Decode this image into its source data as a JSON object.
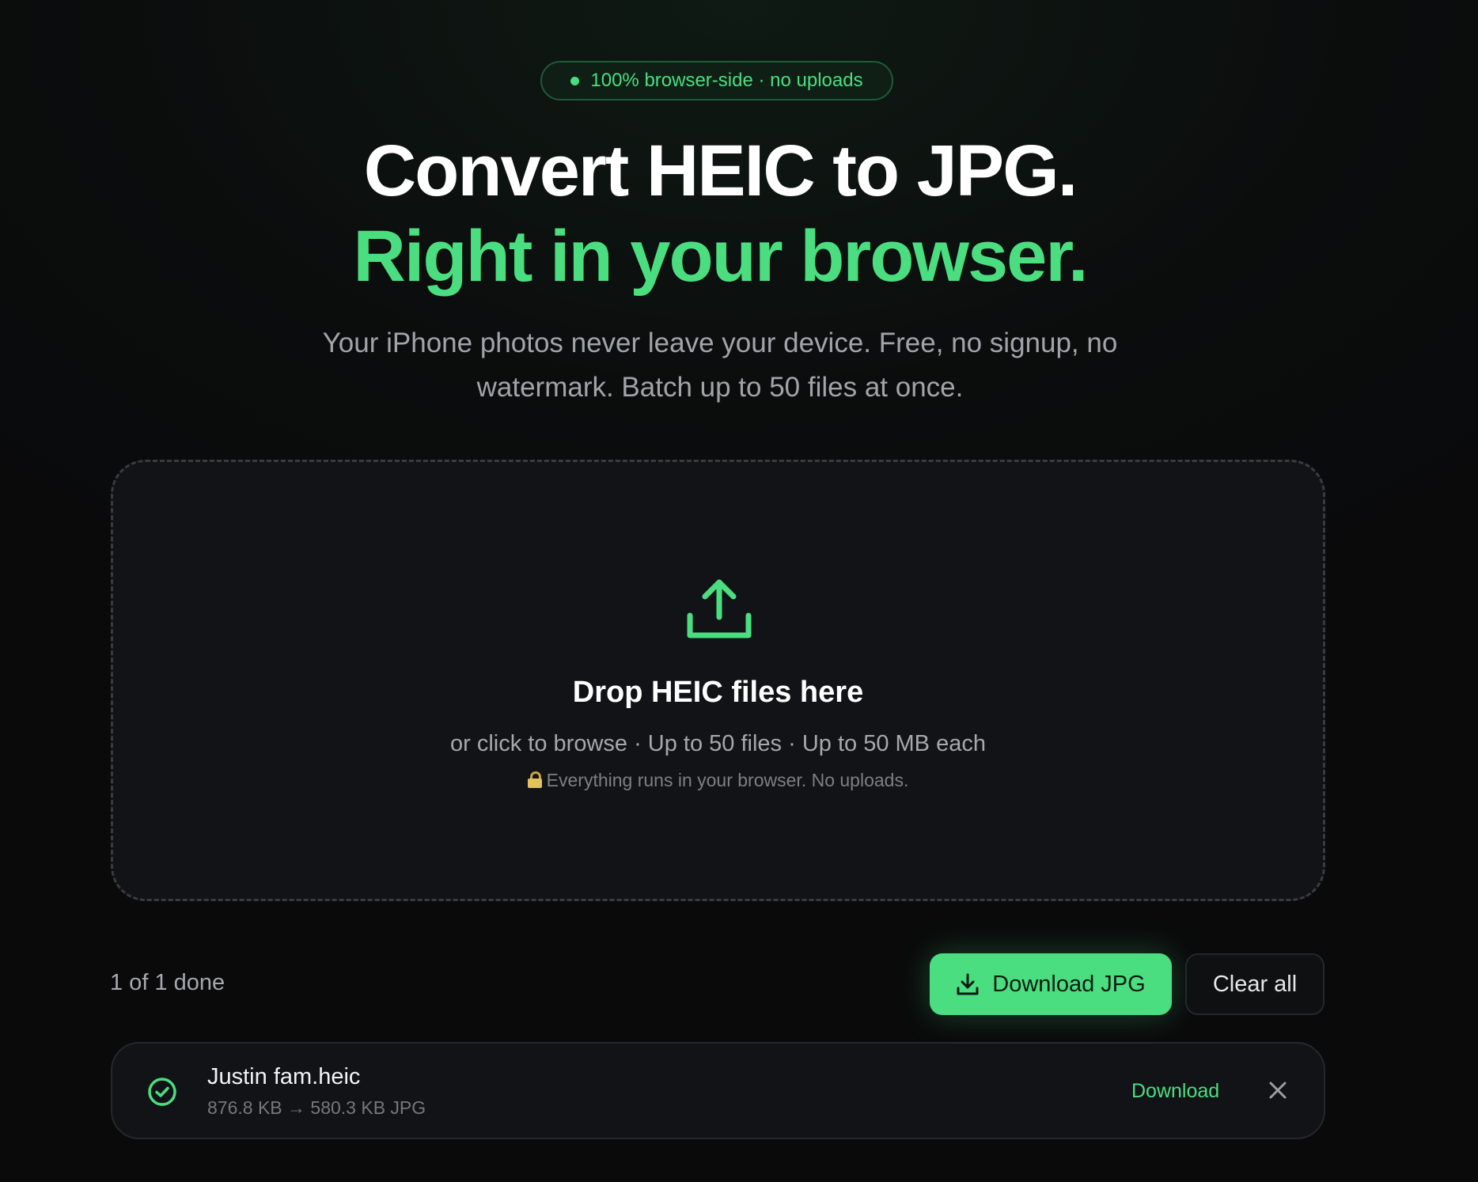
{
  "badge": {
    "text": "100% browser-side · no uploads"
  },
  "hero": {
    "title_line1": "Convert HEIC to JPG.",
    "title_line2": "Right in your browser.",
    "subtitle": "Your iPhone photos never leave your device. Free, no signup, no watermark. Batch up to 50 files at once."
  },
  "dropzone": {
    "icon": "upload-icon",
    "title": "Drop HEIC files here",
    "hint": "or click to browse · Up to 50 files · Up to 50 MB each",
    "note_icon": "lock-icon",
    "note": "Everything runs in your browser. No uploads."
  },
  "actions": {
    "status": "1 of 1 done",
    "download_all_label": "Download JPG",
    "download_all_icon": "download-icon",
    "clear_label": "Clear all"
  },
  "files": [
    {
      "status_icon": "check-circle-icon",
      "name": "Justin fam.heic",
      "meta": "876.8 KB → 580.3 KB JPG",
      "download_label": "Download",
      "remove_icon": "close-icon"
    }
  ],
  "colors": {
    "accent": "#4ade80",
    "background": "#0b0d0d",
    "card": "#121317",
    "muted_text": "#a6a8ad"
  }
}
